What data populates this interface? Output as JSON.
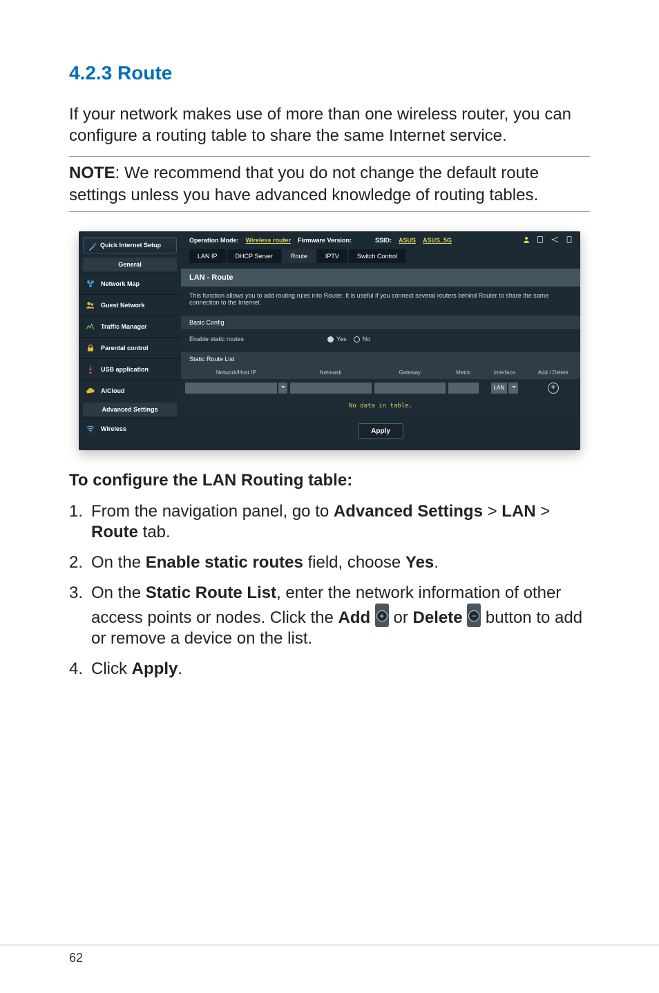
{
  "heading": "4.2.3 Route",
  "intro": "If your network makes use of more than one wireless router, you can configure a routing table to share the same Internet service.",
  "note_label": "NOTE",
  "note_text": ":  We recommend that you do not change the default route settings unless you have advanced knowledge of routing tables.",
  "subheading": "To configure the LAN Routing table:",
  "steps": {
    "s1_a": "From the navigation panel, go to ",
    "s1_b": "Advanced Settings",
    "s1_c": " > ",
    "s1_d": "LAN",
    "s1_e": " > ",
    "s1_f": "Route",
    "s1_g": " tab.",
    "s2_a": "On the ",
    "s2_b": "Enable static routes",
    "s2_c": " field, choose ",
    "s2_d": "Yes",
    "s2_e": ".",
    "s3_a": "On the ",
    "s3_b": "Static Route List",
    "s3_c": ", enter the network information of other access points or nodes. Click the ",
    "s3_d": "Add",
    "s3_e": " or ",
    "s3_f": "Delete",
    "s3_g": " button to add or remove a device on the list.",
    "s4_a": "Click ",
    "s4_b": "Apply",
    "s4_c": "."
  },
  "router": {
    "qi_setup": "Quick Internet Setup",
    "general": "General",
    "adv": "Advanced Settings",
    "nav": {
      "network_map": "Network Map",
      "guest_network": "Guest Network",
      "traffic_manager": "Traffic Manager",
      "parental_control": "Parental control",
      "usb_application": "USB application",
      "aicloud": "AiCloud",
      "wireless": "Wireless"
    },
    "top": {
      "opmode_label": "Operation Mode:",
      "opmode_value": "Wireless router",
      "fw_label": "Firmware Version:",
      "ssid_label": "SSID:",
      "ssid1": "ASUS",
      "ssid2": "ASUS_5G"
    },
    "tabs": {
      "lan_ip": "LAN IP",
      "dhcp": "DHCP Server",
      "route": "Route",
      "iptv": "IPTV",
      "switch": "Switch Control"
    },
    "panel": {
      "title": "LAN - Route",
      "desc": "This function allows you to add routing rules into Router. It is useful if you connect several routers behind Router to share the same connection to the Internet.",
      "basic_config": "Basic Config",
      "enable_static": "Enable static routes",
      "yes": "Yes",
      "no": "No",
      "static_list": "Static Route List",
      "cols": {
        "c1": "Network/Host IP",
        "c2": "Netmask",
        "c3": "Gateway",
        "c4": "Metric",
        "c5": "Interface",
        "c6": "Add / Delete"
      },
      "iface_value": "LAN",
      "no_data": "No data in table.",
      "apply": "Apply"
    }
  },
  "page_number": "62"
}
